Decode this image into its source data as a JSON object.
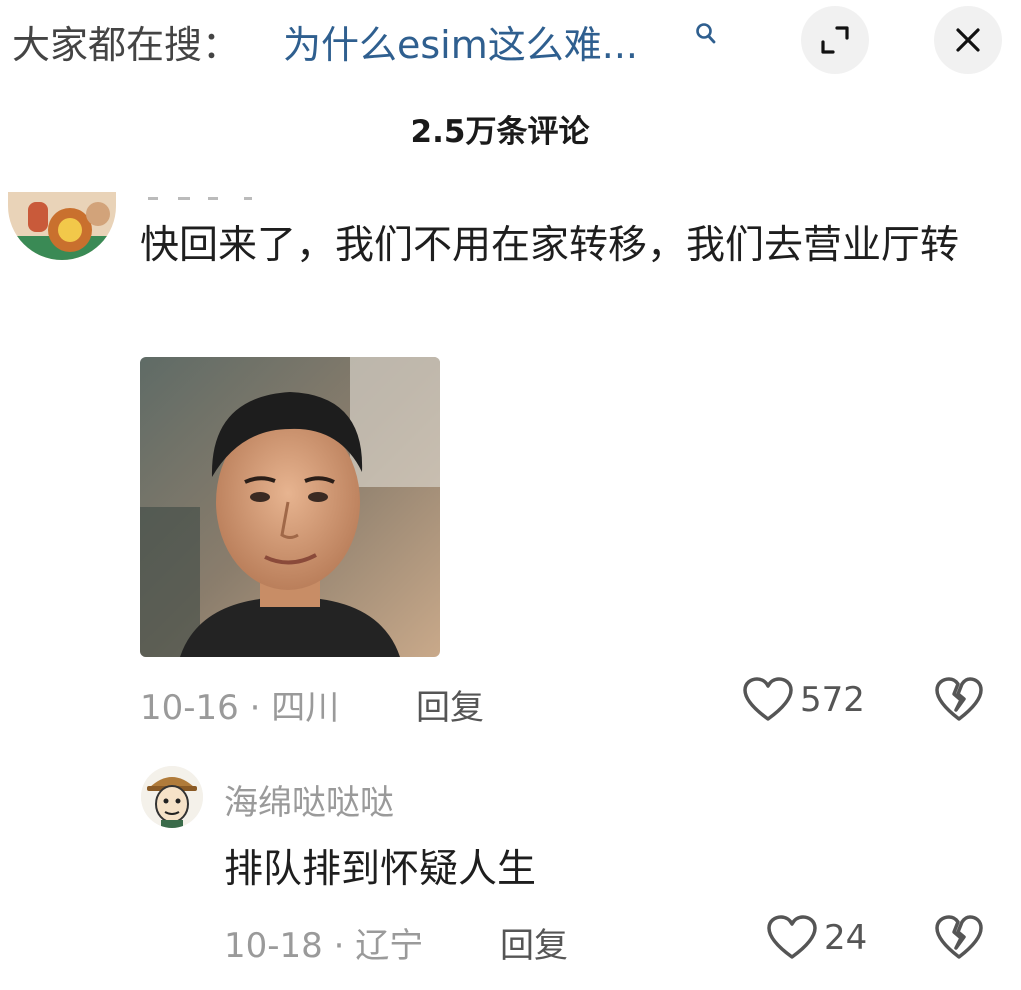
{
  "top_bar": {
    "search_prefix": "大家都在搜：",
    "search_query": "为什么esim这么难...",
    "search_icon": "search-icon",
    "expand_icon": "expand-icon",
    "close_icon": "close-icon"
  },
  "comments_header": {
    "count_label": "2.5万条评论"
  },
  "comment": {
    "text": "快回来了，我们不用在家转移，我们去营业厅转",
    "date": "10-16",
    "separator": "·",
    "location": "四川",
    "reply_label": "回复",
    "like_count": "572",
    "like_icon": "heart-icon",
    "dislike_icon": "broken-heart-icon"
  },
  "reply": {
    "username": "海绵哒哒哒",
    "text": "排队排到怀疑人生",
    "date": "10-18",
    "separator": "·",
    "location": "辽宁",
    "reply_label": "回复",
    "like_count": "24",
    "like_icon": "heart-icon",
    "dislike_icon": "broken-heart-icon"
  }
}
